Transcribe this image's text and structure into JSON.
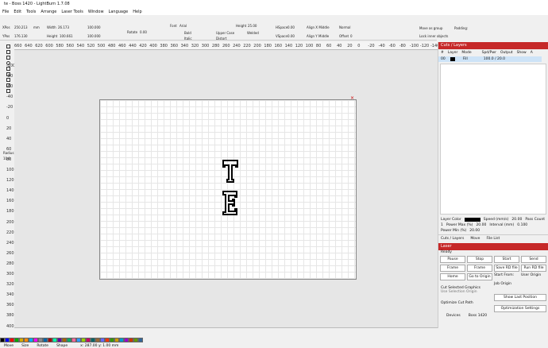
{
  "title": "te - Boss 1420 - LightBurn 1.7.08",
  "menu": [
    "File",
    "Edit",
    "Tools",
    "Arrange",
    "Laser Tools",
    "Window",
    "Language",
    "Help"
  ],
  "props": {
    "xpos_label": "XPos",
    "xpos": "250.213",
    "ypos_label": "YPos",
    "ypos": "176.130",
    "unit": "mm",
    "width_label": "Width",
    "width": "26.173",
    "height_label": "Height",
    "height": "100.661",
    "pct_w": "100.000",
    "pct_h": "100.000",
    "pct_sign": "%",
    "rotate_label": "Rotate",
    "rotate": "0.00",
    "font_label": "Font",
    "font": "Arial",
    "size_label": "Height",
    "size": "25.00",
    "bold": "Bold",
    "italic": "Italic",
    "upper": "Upper Case",
    "distort": "Distort",
    "welded": "Welded",
    "hspace_label": "HSpace",
    "hspace": "0.00",
    "vspace_label": "VSpace",
    "vspace": "0.00",
    "alignx": "Align X Middle",
    "aligny": "Align Y Middle",
    "normal": "Normal",
    "offset_label": "Offset",
    "offset": "0",
    "move_group": "Move as group",
    "lock_inner": "Lock inner objects",
    "padding": "Padding:"
  },
  "ruler_top": [
    "660",
    "640",
    "620",
    "600",
    "580",
    "560",
    "540",
    "520",
    "500",
    "480",
    "460",
    "440",
    "420",
    "400",
    "380",
    "360",
    "340",
    "320",
    "300",
    "280",
    "260",
    "240",
    "220",
    "200",
    "180",
    "160",
    "140",
    "120",
    "100",
    "80",
    "60",
    "40",
    "20",
    "0",
    "-20",
    "-40",
    "-60",
    "-80",
    "-100",
    "-120",
    "-140"
  ],
  "ruler_left": [
    "-100",
    "-80",
    "-60",
    "-40",
    "-20",
    "0",
    "20",
    "40",
    "60",
    "80",
    "100",
    "120",
    "140",
    "160",
    "180",
    "200",
    "220",
    "240",
    "260",
    "280",
    "300",
    "320",
    "340",
    "360",
    "380",
    "400",
    "420"
  ],
  "radius_label": "Radius:",
  "radius": "10.0",
  "cuts": {
    "header": "Cuts / Layers",
    "cols": [
      "#",
      "Layer",
      "Mode",
      "Spd/Pwr",
      "Output",
      "Show",
      "A"
    ],
    "row": {
      "num": "00",
      "mode": "Fill",
      "spd": "100.0 / 20.0"
    },
    "layer_color": "Layer Color",
    "speed_label": "Speed (mm/s)",
    "speed": "20.00",
    "pass_label": "Pass Count",
    "pass": "1",
    "pmax_label": "Power Max (%)",
    "pmax": "20.00",
    "interval_label": "Interval (mm)",
    "interval": "0.100",
    "pmin_label": "Power Min (%)",
    "pmin": "20.00",
    "tabs": [
      "Cuts / Layers",
      "Move",
      "File List"
    ],
    "layer_color_hex": "#000000"
  },
  "laser": {
    "header": "Laser",
    "status": "Ready",
    "pause": "Pause",
    "stop": "Stop",
    "start": "Start",
    "send": "Send",
    "home": "Home",
    "frame1": "Frame",
    "frame2": "Frame",
    "save_rd": "Save RD file",
    "run_rd": "Run RD file",
    "home2": "Home",
    "goto": "Go to Origin",
    "start_from": "Start From:",
    "start_from_val": "User Origin",
    "job_origin": "Job Origin",
    "cut_sel": "Cut Selected Graphics",
    "use_sel": "Use Selection Origin",
    "show_last": "Show Last Position",
    "optimize": "Optimize Cut Path",
    "opt_settings": "Optimization Settings",
    "devices": "Devices",
    "device": "Boss 1420"
  },
  "status": {
    "tabs": [
      "Move",
      "Size",
      "Rotate",
      "Shape"
    ],
    "coords": "x: 287.00 y: 1.00 mm"
  },
  "colors": {
    "accent": "#c62828",
    "bed": "#ffffff",
    "canvas": "#e6e6e6"
  },
  "palette": [
    "#000000",
    "#0000ff",
    "#ff0000",
    "#00aa00",
    "#d4aa00",
    "#ff8800",
    "#00aaff",
    "#ff00ff",
    "#888888",
    "#0066aa",
    "#aa0000",
    "#00ffaa",
    "#6600aa",
    "#aa6600",
    "#00aa66",
    "#ff6699",
    "#3399ff",
    "#99cc00",
    "#cc0066",
    "#006666",
    "#996633",
    "#6666ff",
    "#ff3300",
    "#339900",
    "#cc9900",
    "#0099cc",
    "#9900cc",
    "#cc3300",
    "#669900",
    "#336699"
  ]
}
